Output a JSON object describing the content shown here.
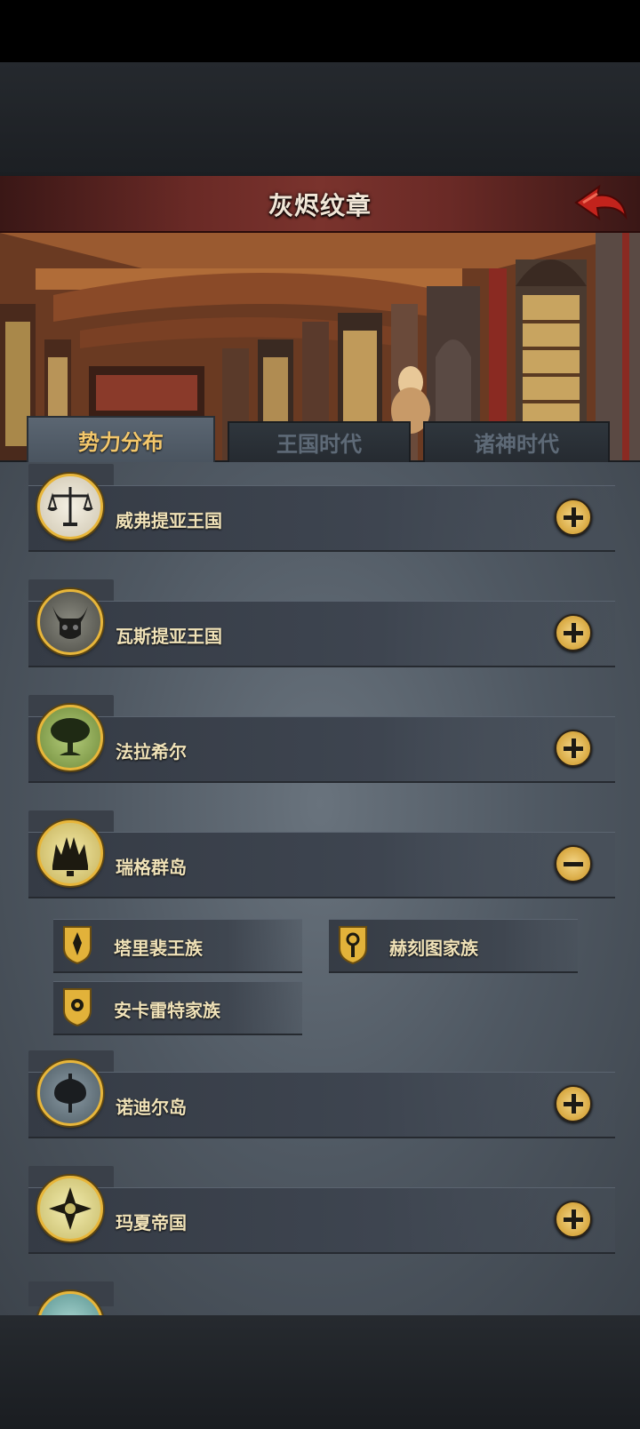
{
  "header": {
    "title": "灰烬纹章"
  },
  "tabs": [
    {
      "label": "势力分布",
      "active": true
    },
    {
      "label": "王国时代",
      "active": false
    },
    {
      "label": "诸神时代",
      "active": false
    }
  ],
  "factions": [
    {
      "name": "威弗提亚王国",
      "icon": "scales-icon",
      "expanded": false
    },
    {
      "name": "瓦斯提亚王国",
      "icon": "demon-horns-icon",
      "expanded": false
    },
    {
      "name": "法拉希尔",
      "icon": "tree-icon",
      "expanded": false
    },
    {
      "name": "瑞格群岛",
      "icon": "crown-castle-icon",
      "expanded": true,
      "houses": [
        {
          "name": "塔里裴王族",
          "icon": "flame-shield-icon"
        },
        {
          "name": "赫刻图家族",
          "icon": "eye-shield-icon"
        },
        {
          "name": "安卡雷特家族",
          "icon": "sun-shield-icon"
        }
      ]
    },
    {
      "name": "诺迪尔岛",
      "icon": "axe-icon",
      "expanded": false
    },
    {
      "name": "玛夏帝国",
      "icon": "compass-cross-icon",
      "expanded": false
    }
  ],
  "colors": {
    "accent_gold": "#e8b63a",
    "title_bar": "#6a2a26",
    "active_tab_text": "#f3c76b"
  }
}
